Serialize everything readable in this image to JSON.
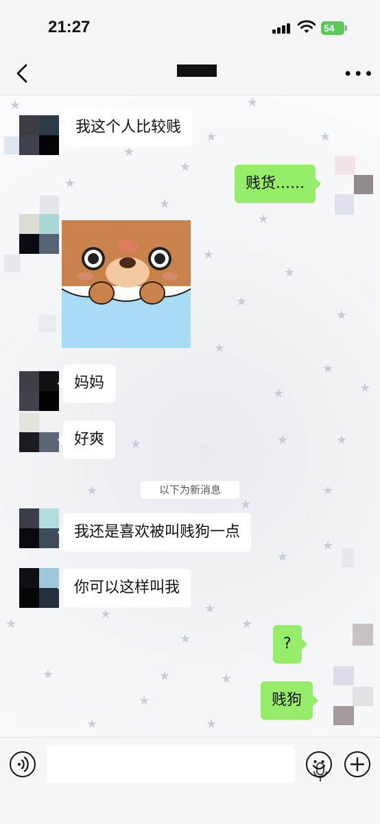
{
  "status_bar": {
    "time": "21:27",
    "battery": "54"
  },
  "nav": {
    "back_icon": "chevron-left-icon",
    "more_icon": "more-dots-icon",
    "more_label": "•••"
  },
  "messages": [
    {
      "side": "in",
      "text": "我这个人比较贱"
    },
    {
      "side": "out",
      "text": "贱货......"
    },
    {
      "side": "in",
      "type": "sticker",
      "sticker": "bear-peeking-sticker"
    },
    {
      "side": "in",
      "text": "妈妈"
    },
    {
      "side": "in",
      "text": "好爽"
    },
    {
      "side": "in",
      "text": "我还是喜欢被叫贱狗一点"
    },
    {
      "side": "in",
      "text": "你可以这样叫我"
    },
    {
      "side": "out",
      "text": "?"
    },
    {
      "side": "out",
      "text": "贱狗"
    }
  ],
  "separator": "以下为新消息",
  "input_bar": {
    "voice_icon": "voice-icon",
    "mic_icon": "mic-icon",
    "emoji_icon": "emoji-icon",
    "plus_icon": "plus-icon"
  },
  "colors": {
    "outgoing_bubble": "#95ec69",
    "incoming_bubble": "#ffffff",
    "background": "#f3f4f7"
  }
}
